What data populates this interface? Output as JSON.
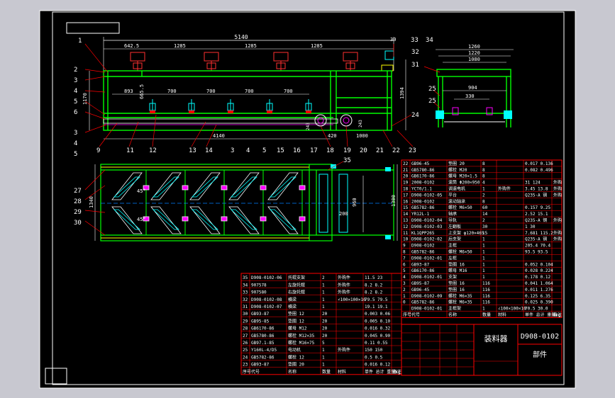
{
  "drawing": {
    "title": "装料器",
    "code": "D908-0102",
    "type": "部件"
  },
  "side_view": {
    "dims_top": [
      "5140",
      "642.5",
      "1285",
      "1285",
      "1285",
      "30"
    ],
    "dims_spacing": [
      "893",
      "700",
      "700",
      "700",
      "700"
    ],
    "dims_vert": [
      "1170",
      "665.5",
      "1394"
    ],
    "dims_bottom": [
      "4140",
      "420",
      "1000",
      "243",
      "243"
    ],
    "balloons_top": [
      "1",
      "33",
      "34",
      "32",
      "31"
    ],
    "balloons_left": [
      "2",
      "3",
      "4",
      "5",
      "6",
      "3",
      "4",
      "5"
    ],
    "balloons_bottom": [
      "9",
      "11",
      "12",
      "13",
      "14",
      "3",
      "4",
      "5",
      "15",
      "16",
      "17",
      "18",
      "19",
      "20",
      "21",
      "22",
      "23",
      "24"
    ]
  },
  "end_view": {
    "dims": [
      "1260",
      "1220",
      "1080",
      "904",
      "330"
    ],
    "balloons": [
      "25",
      "25"
    ]
  },
  "plan_view": {
    "dims": [
      "1340",
      "1300",
      "960",
      "200"
    ],
    "angle": "45°",
    "balloons_left": [
      "27",
      "28",
      "29",
      "30"
    ],
    "balloons_top": [
      "35"
    ]
  },
  "bom_right": {
    "rows": [
      [
        "22",
        "GB96-45",
        "垫圈 20",
        "8",
        "",
        "0.017 0.136",
        ""
      ],
      [
        "21",
        "GB5780-86",
        "螺栓 M20",
        "8",
        "",
        "0.082 0.496",
        ""
      ],
      [
        "20",
        "GB6170-86",
        "螺母 M20×1.5",
        "8",
        "",
        "",
        ""
      ],
      [
        "19",
        "2008-0102",
        "滚筒 Φ200×950",
        "4",
        "",
        "31 124",
        "外购"
      ],
      [
        "18",
        "YCT0/1.1",
        "调速电机",
        "1",
        "外购件",
        "3.45 13.8",
        "外购"
      ],
      [
        "17",
        "D908-0102-05",
        "平台",
        "2",
        "",
        "Q235-A 钢",
        "外购"
      ],
      [
        "16",
        "2008-0102",
        "滚动轴承",
        "8",
        "",
        "",
        ""
      ],
      [
        "15",
        "GB5782-86",
        "螺栓 M6×50",
        "60",
        "",
        "0.157 9.25",
        ""
      ],
      [
        "14",
        "YR12L-1",
        "轴承",
        "14",
        "",
        "2.52 15.1",
        ""
      ],
      [
        "13",
        "D908-0102-04",
        "导轨",
        "2",
        "",
        "Q235-A 钢",
        "外购"
      ],
      [
        "12",
        "D908-0102-03",
        "左翻板",
        "30",
        "",
        "1 30",
        ""
      ],
      [
        "11",
        "KL1QPP265",
        "上支架 φ120×465",
        "15",
        "",
        "7.681 115.2",
        "外购"
      ],
      [
        "10",
        "D908-0102-02",
        "后支架",
        "1",
        "",
        "Q235-A 钢",
        "外购"
      ],
      [
        "9",
        "D908-0102",
        "主框",
        "1",
        "",
        "205.4 70.4",
        ""
      ],
      [
        "8",
        "GB5782-86",
        "螺栓 M6×50",
        "1",
        "",
        "93.5 93.5",
        ""
      ],
      [
        "7",
        "D908-0102-01",
        "左框",
        "1",
        "",
        "",
        ""
      ],
      [
        "6",
        "GB93-87",
        "垫圈 16",
        "1",
        "",
        "0.052 0.104",
        ""
      ],
      [
        "5",
        "GB6170-86",
        "螺母 M16",
        "1",
        "",
        "0.028 0.224",
        ""
      ],
      [
        "4",
        "D908-0102-01",
        "支架",
        "1",
        "",
        "0.178 0.12",
        ""
      ],
      [
        "3",
        "GB95-87",
        "垫圈 16",
        "116",
        "",
        "0.041 1.064",
        ""
      ],
      [
        "2",
        "GB96-45",
        "垫圈 16",
        "116",
        "",
        "0.011 1.276",
        ""
      ],
      [
        "1",
        "D908-0102-09",
        "螺栓 M6×35",
        "116",
        "",
        "0.125 6.35",
        ""
      ],
      [
        "0",
        "GB5782-86",
        "螺栓 M6×35",
        "116",
        "",
        "0.025 0.390",
        ""
      ],
      [
        "",
        "D908-0102-01",
        "主框架",
        "1",
        "∠100×100×10",
        "70.5 30.0",
        ""
      ]
    ],
    "header": [
      "序号",
      "代号",
      "名称",
      "数量",
      "材料",
      "单件 总计 重量kg",
      "备注"
    ]
  },
  "bom_left": {
    "rows": [
      [
        "35",
        "D908-0102-06",
        "托辊支架",
        "2",
        "外购件",
        "11.5 23",
        ""
      ],
      [
        "34",
        "907578",
        "左旋托辊",
        "1",
        "外购件",
        "8.2 8.2",
        ""
      ],
      [
        "33",
        "907580",
        "右旋托辊",
        "1",
        "外购件",
        "8.2 8.2",
        ""
      ],
      [
        "32",
        "D908-0102-08",
        "横梁",
        "1",
        "∠100×100×10",
        "79.5 79.5",
        ""
      ],
      [
        "31",
        "D908-0102-07",
        "横梁",
        "1",
        "",
        "19.1 19.1",
        ""
      ],
      [
        "30",
        "GB93-87",
        "垫圈 12",
        "20",
        "",
        "0.003 0.06",
        ""
      ],
      [
        "29",
        "GB95-85",
        "垫圈 12",
        "20",
        "",
        "0.005 0.10",
        ""
      ],
      [
        "28",
        "GB6170-86",
        "螺母 M12",
        "20",
        "",
        "0.016 0.32",
        ""
      ],
      [
        "27",
        "GB5780-86",
        "螺栓 M12×35",
        "20",
        "",
        "0.045 0.90",
        ""
      ],
      [
        "26",
        "GB97.1-85",
        "螺栓 M16×75",
        "5",
        "",
        "0.11 0.55",
        ""
      ],
      [
        "25",
        "Y160L-4/D5",
        "电动机",
        "1",
        "外购件",
        "150 150",
        ""
      ],
      [
        "24",
        "GB5782-86",
        "螺栓 12",
        "1",
        "",
        "0.5 0.5",
        ""
      ],
      [
        "23",
        "GB93-87",
        "垫圈 20",
        "1",
        "",
        "0.016 0.12",
        ""
      ]
    ],
    "header": [
      "序号",
      "代号",
      "名称",
      "数量",
      "材料",
      "单件 总计 重量kg",
      "备注"
    ]
  },
  "colors": {
    "background": "#000000",
    "frame": "#ffffff",
    "part": "#00ff00",
    "dimension": "#ffffff",
    "leader": "#ff0000",
    "hidden": "#00ffff",
    "accent": "#ffff00",
    "magenta": "#ff00ff",
    "table_grid": "#ff0000"
  }
}
